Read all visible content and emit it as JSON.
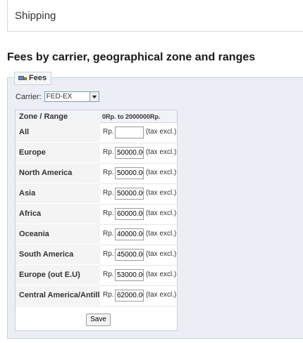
{
  "shipping": {
    "title": "Shipping"
  },
  "section": {
    "title": "Fees by carrier, geographical zone and ranges"
  },
  "fieldset": {
    "legend": "Fees",
    "legend_icon": "truck-icon"
  },
  "carrier": {
    "label": "Carrier:",
    "selected": "FED-EX"
  },
  "table": {
    "header_zone": "Zone / Range",
    "header_range": "0Rp. to 2000000Rp.",
    "currency_prefix": "Rp.",
    "tax_suffix": "(tax excl.)",
    "rows": [
      {
        "zone": "All",
        "fee": ""
      },
      {
        "zone": "Europe",
        "fee": "50000.00"
      },
      {
        "zone": "North America",
        "fee": "50000.00"
      },
      {
        "zone": "Asia",
        "fee": "50000.00"
      },
      {
        "zone": "Africa",
        "fee": "60000.00"
      },
      {
        "zone": "Oceania",
        "fee": "40000.00"
      },
      {
        "zone": "South America",
        "fee": "45000.00"
      },
      {
        "zone": "Europe (out E.U)",
        "fee": "53000.00"
      },
      {
        "zone": "Central America/Antilla",
        "fee": "62000.00"
      }
    ]
  },
  "save_label": "Save"
}
